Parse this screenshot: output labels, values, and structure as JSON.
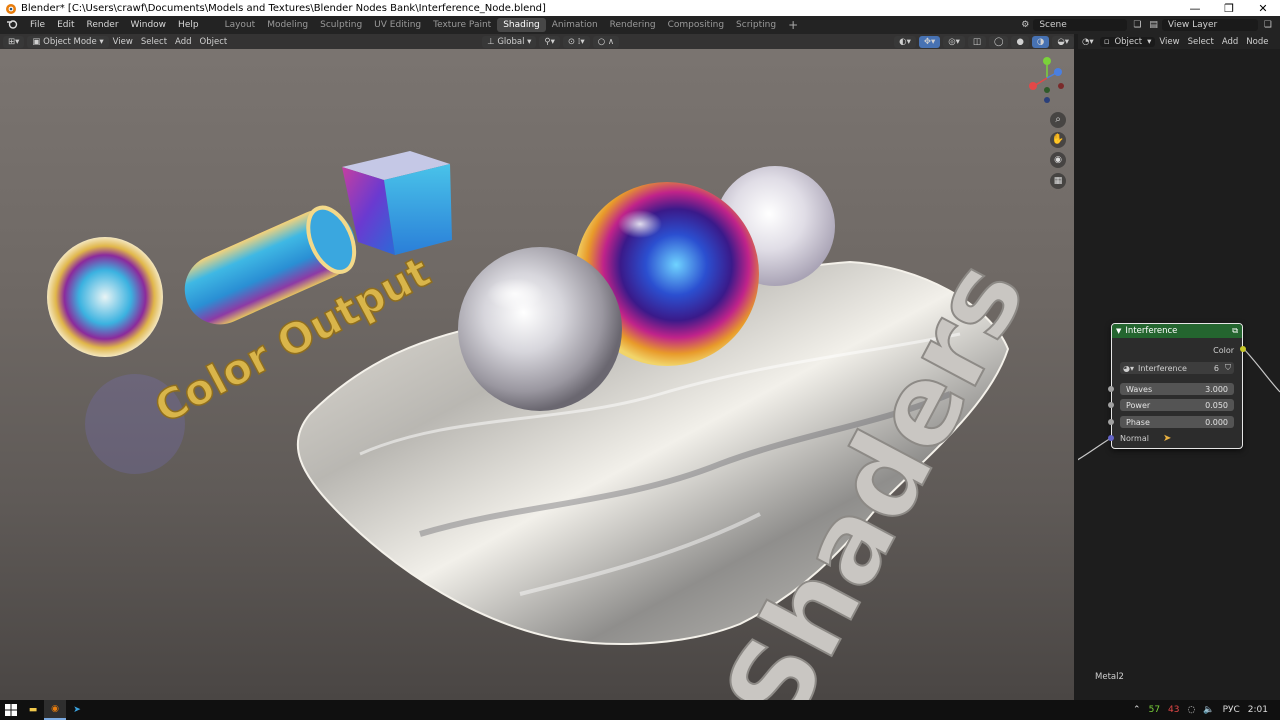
{
  "window": {
    "title": "Blender* [C:\\Users\\crawf\\Documents\\Models and Textures\\Blender Nodes Bank\\Interference_Node.blend]",
    "controls": [
      "—",
      "❐",
      "✕"
    ]
  },
  "menubar": {
    "menus": [
      "File",
      "Edit",
      "Render",
      "Window",
      "Help"
    ],
    "workspaces": [
      "Layout",
      "Modeling",
      "Sculpting",
      "UV Editing",
      "Texture Paint",
      "Shading",
      "Animation",
      "Rendering",
      "Compositing",
      "Scripting"
    ],
    "active_workspace": "Shading",
    "add_tab": "+",
    "scene": "Scene",
    "view_layer": "View Layer"
  },
  "viewport_header": {
    "mode": "Object Mode",
    "menus": [
      "View",
      "Select",
      "Add",
      "Object"
    ],
    "transform": "Global"
  },
  "viewport": {
    "scene_text_1": "Color Output",
    "scene_text_2": "Shaders"
  },
  "node_editor": {
    "header": {
      "type": "Object",
      "menus": [
        "View",
        "Select",
        "Add",
        "Node"
      ]
    },
    "node": {
      "title": "Interference",
      "output_socket": "Color",
      "group": {
        "name": "Interference",
        "users": "6"
      },
      "inputs": [
        {
          "label": "Waves",
          "value": "3.000"
        },
        {
          "label": "Power",
          "value": "0.050"
        },
        {
          "label": "Phase",
          "value": "0.000"
        }
      ],
      "normal_label": "Normal"
    },
    "material_name": "Metal2"
  },
  "taskbar": {
    "tray": {
      "cpu": "57",
      "temp": "43",
      "lang": "РУС",
      "time": "2:01"
    }
  },
  "colors": {
    "accent_active": "#474747",
    "node_header": "#24652f",
    "socket_gray": "#a1a1a1",
    "socket_blue": "#6363c7",
    "socket_yellow": "#c7c729"
  }
}
